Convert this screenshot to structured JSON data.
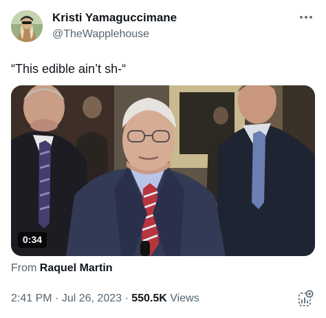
{
  "author": {
    "display_name": "Kristi Yamaguccimane",
    "handle": "@TheWapplehouse"
  },
  "tweet": {
    "text": "“This edible ain’t sh-“"
  },
  "media": {
    "duration": "0:34"
  },
  "attribution": {
    "prefix": "From",
    "name": "Raquel Martin"
  },
  "meta": {
    "time": "2:41 PM",
    "separator": "·",
    "date": "Jul 26, 2023",
    "views_count": "550.5K",
    "views_label": "Views"
  },
  "icons": {
    "more": "more-icon",
    "analytics": "analytics-icon"
  },
  "colors": {
    "text_primary": "#0f1419",
    "text_secondary": "#536471",
    "background": "#ffffff"
  }
}
